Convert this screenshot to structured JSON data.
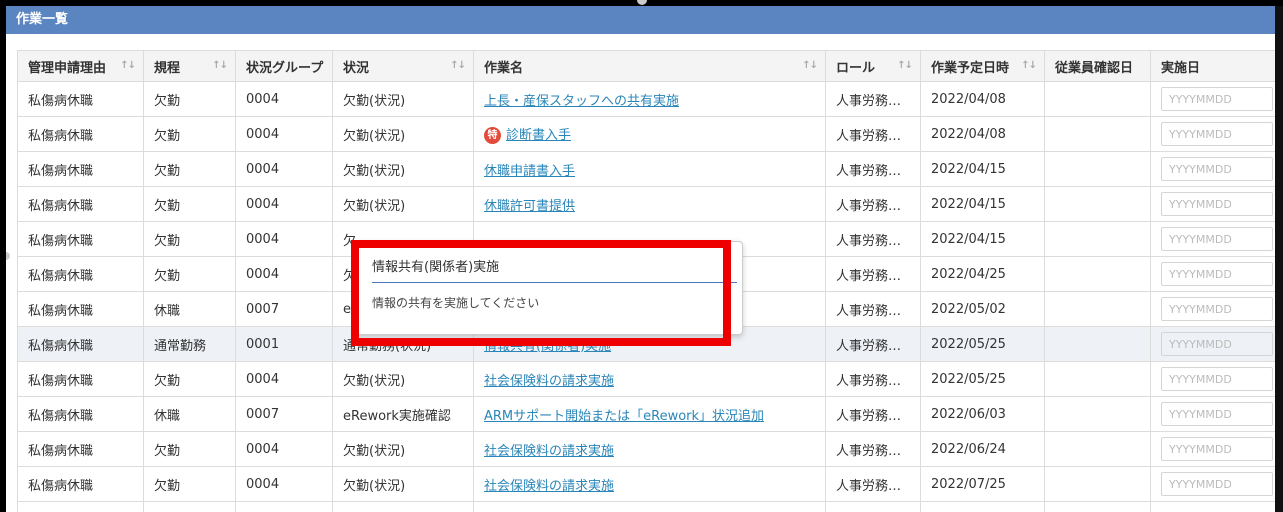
{
  "panel": {
    "title": "作業一覧"
  },
  "columns": [
    {
      "label": "管理申請理由",
      "sortable": true
    },
    {
      "label": "規程",
      "sortable": true
    },
    {
      "label": "状況グループ",
      "sortable": false
    },
    {
      "label": "状況",
      "sortable": true
    },
    {
      "label": "作業名",
      "sortable": true
    },
    {
      "label": "ロール",
      "sortable": true
    },
    {
      "label": "作業予定日時",
      "sortable": true
    },
    {
      "label": "従業員確認日",
      "sortable": false
    },
    {
      "label": "実施日",
      "sortable": true
    }
  ],
  "date_placeholder": "YYYYMMDD",
  "rows": [
    {
      "reason": "私傷病休職",
      "rule": "欠勤",
      "group": "0004",
      "status": "欠勤(状況)",
      "task": "上長・産保スタッフへの共有実施",
      "badge": "",
      "role": "人事労務…",
      "date": "2022/04/08",
      "highlight": false
    },
    {
      "reason": "私傷病休職",
      "rule": "欠勤",
      "group": "0004",
      "status": "欠勤(状況)",
      "task": "診断書入手",
      "badge": "特",
      "role": "人事労務…",
      "date": "2022/04/08",
      "highlight": false
    },
    {
      "reason": "私傷病休職",
      "rule": "欠勤",
      "group": "0004",
      "status": "欠勤(状況)",
      "task": "休職申請書入手",
      "badge": "",
      "role": "人事労務…",
      "date": "2022/04/15",
      "highlight": false
    },
    {
      "reason": "私傷病休職",
      "rule": "欠勤",
      "group": "0004",
      "status": "欠勤(状況)",
      "task": "休職許可書提供",
      "badge": "",
      "role": "人事労務…",
      "date": "2022/04/15",
      "highlight": false
    },
    {
      "reason": "私傷病休職",
      "rule": "欠勤",
      "group": "0004",
      "status": "欠",
      "task": "",
      "badge": "",
      "role": "人事労務…",
      "date": "2022/04/15",
      "highlight": false
    },
    {
      "reason": "私傷病休職",
      "rule": "欠勤",
      "group": "0004",
      "status": "欠",
      "task": "",
      "badge": "",
      "role": "人事労務…",
      "date": "2022/04/25",
      "highlight": false
    },
    {
      "reason": "私傷病休職",
      "rule": "休職",
      "group": "0007",
      "status": "e",
      "task": "",
      "badge": "",
      "role": "人事労務…",
      "date": "2022/05/02",
      "highlight": false
    },
    {
      "reason": "私傷病休職",
      "rule": "通常勤務",
      "group": "0001",
      "status": "通常勤務(状況)",
      "task": "情報共有(関係者)実施",
      "badge": "",
      "role": "人事労務…",
      "date": "2022/05/25",
      "highlight": true
    },
    {
      "reason": "私傷病休職",
      "rule": "欠勤",
      "group": "0004",
      "status": "欠勤(状況)",
      "task": "社会保険料の請求実施",
      "badge": "",
      "role": "人事労務…",
      "date": "2022/05/25",
      "highlight": false
    },
    {
      "reason": "私傷病休職",
      "rule": "休職",
      "group": "0007",
      "status": "eRework実施確認",
      "task": "ARMサポート開始または「eRework」状況追加",
      "badge": "",
      "role": "人事労務…",
      "date": "2022/06/03",
      "highlight": false
    },
    {
      "reason": "私傷病休職",
      "rule": "欠勤",
      "group": "0004",
      "status": "欠勤(状況)",
      "task": "社会保険料の請求実施",
      "badge": "",
      "role": "人事労務…",
      "date": "2022/06/24",
      "highlight": false
    },
    {
      "reason": "私傷病休職",
      "rule": "欠勤",
      "group": "0004",
      "status": "欠勤(状況)",
      "task": "社会保険料の請求実施",
      "badge": "",
      "role": "人事労務…",
      "date": "2022/07/25",
      "highlight": false
    },
    {
      "reason": "",
      "rule": "",
      "group": "",
      "status": "",
      "task": "",
      "badge": "",
      "role": "",
      "date": "",
      "highlight": false
    }
  ],
  "tooltip": {
    "title": "情報共有(関係者)実施",
    "body": "情報の共有を実施してください"
  },
  "colors": {
    "header_bg": "#5a85c1",
    "link": "#2a86b8",
    "highlight_box": "#ee0000",
    "badge": "#e24b3b"
  }
}
